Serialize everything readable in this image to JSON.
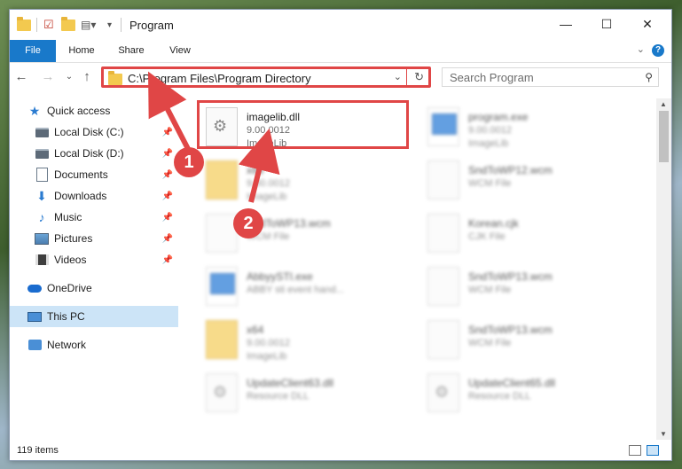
{
  "window": {
    "title": "Program",
    "controls": {
      "minimize": "—",
      "maximize": "☐",
      "close": "✕"
    }
  },
  "ribbon": {
    "tabs": [
      "File",
      "Home",
      "Share",
      "View"
    ],
    "help": "?"
  },
  "navigation": {
    "address": "C:\\Program Files\\Program Directory",
    "search_placeholder": "Search Program"
  },
  "sidebar": {
    "items": [
      {
        "label": "Quick access",
        "icon": "star-icon",
        "pinned": false
      },
      {
        "label": "Local Disk (C:)",
        "icon": "drive-icon",
        "pinned": true
      },
      {
        "label": "Local Disk (D:)",
        "icon": "drive-icon",
        "pinned": true
      },
      {
        "label": "Documents",
        "icon": "document-icon",
        "pinned": true
      },
      {
        "label": "Downloads",
        "icon": "download-icon",
        "pinned": true
      },
      {
        "label": "Music",
        "icon": "music-icon",
        "pinned": true
      },
      {
        "label": "Pictures",
        "icon": "pictures-icon",
        "pinned": true
      },
      {
        "label": "Videos",
        "icon": "video-icon",
        "pinned": true
      },
      {
        "label": "OneDrive",
        "icon": "cloud-icon",
        "pinned": false
      },
      {
        "label": "This PC",
        "icon": "computer-icon",
        "pinned": false,
        "selected": true
      },
      {
        "label": "Network",
        "icon": "network-icon",
        "pinned": false
      }
    ]
  },
  "files": [
    {
      "name": "imagelib.dll",
      "line1": "9.00.0012",
      "line2": "ImageLib",
      "type": "dll"
    },
    {
      "name": "program.exe",
      "line1": "9.00.0012",
      "line2": "ImageLib",
      "type": "exe"
    },
    {
      "name": "x86",
      "line1": "9.00.0012",
      "line2": "ImageLib",
      "type": "folder"
    },
    {
      "name": "SndToWP12.wcm",
      "line1": "WCM File",
      "line2": "",
      "type": "file"
    },
    {
      "name": "SndToWP13.wcm",
      "line1": "WCM File",
      "line2": "",
      "type": "file"
    },
    {
      "name": "Korean.cjk",
      "line1": "CJK File",
      "line2": "",
      "type": "file"
    },
    {
      "name": "AbbyySTI.exe",
      "line1": "ABBY sti event hand...",
      "line2": "",
      "type": "exe"
    },
    {
      "name": "SndToWP13.wcm",
      "line1": "WCM File",
      "line2": "",
      "type": "file"
    },
    {
      "name": "x64",
      "line1": "9.00.0012",
      "line2": "ImageLib",
      "type": "folder"
    },
    {
      "name": "SndToWP13.wcm",
      "line1": "WCM File",
      "line2": "",
      "type": "file"
    },
    {
      "name": "UpdateClient63.dll",
      "line1": "Resource DLL",
      "line2": "",
      "type": "dll"
    },
    {
      "name": "UpdateClient65.dll",
      "line1": "Resource DLL",
      "line2": "",
      "type": "dll"
    }
  ],
  "status": {
    "items": "119 items"
  },
  "callouts": [
    "1",
    "2"
  ],
  "colors": {
    "accent": "#1979ca",
    "annotation": "#e04646",
    "selected": "#cce4f7"
  }
}
